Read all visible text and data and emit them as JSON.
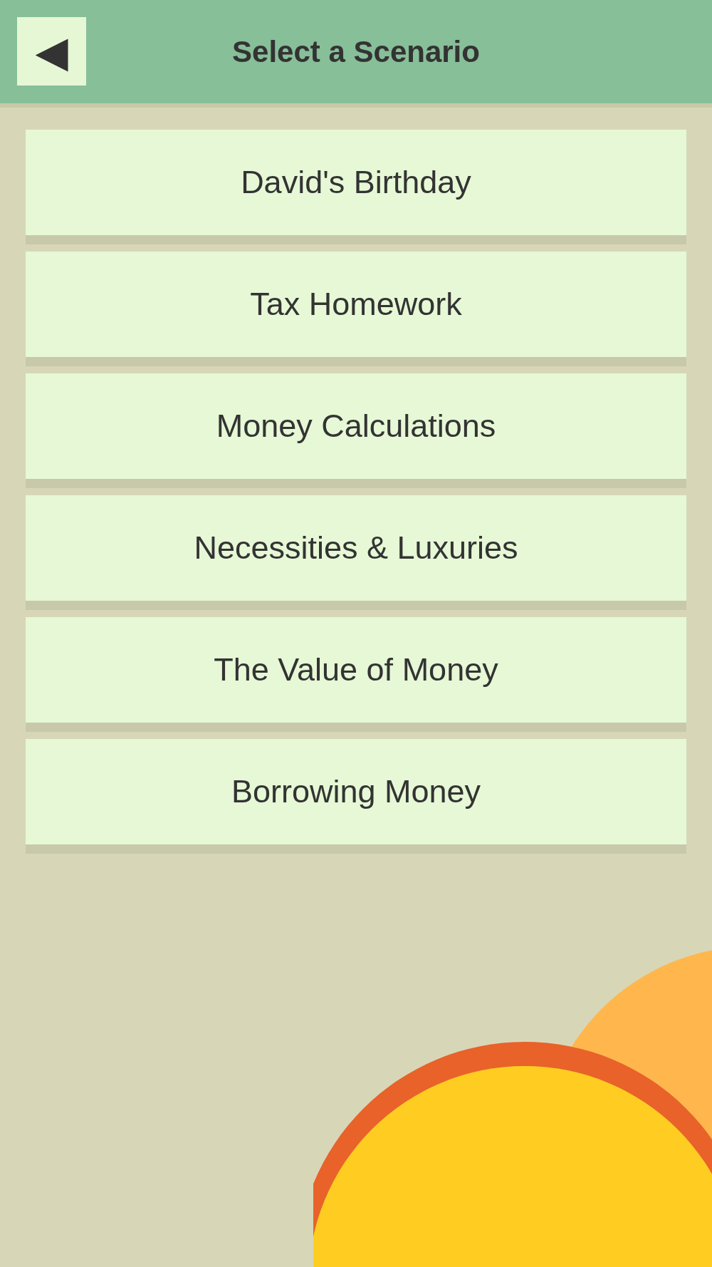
{
  "header": {
    "title": "Select a Scenario",
    "back_button": {
      "label": "◀"
    }
  },
  "scenarios": [
    {
      "label": "David's Birthday"
    },
    {
      "label": "Tax Homework"
    },
    {
      "label": "Money Calculations"
    },
    {
      "label": "Necessities & Luxuries"
    },
    {
      "label": "The Value of Money"
    },
    {
      "label": "Borrowing Money"
    }
  ]
}
